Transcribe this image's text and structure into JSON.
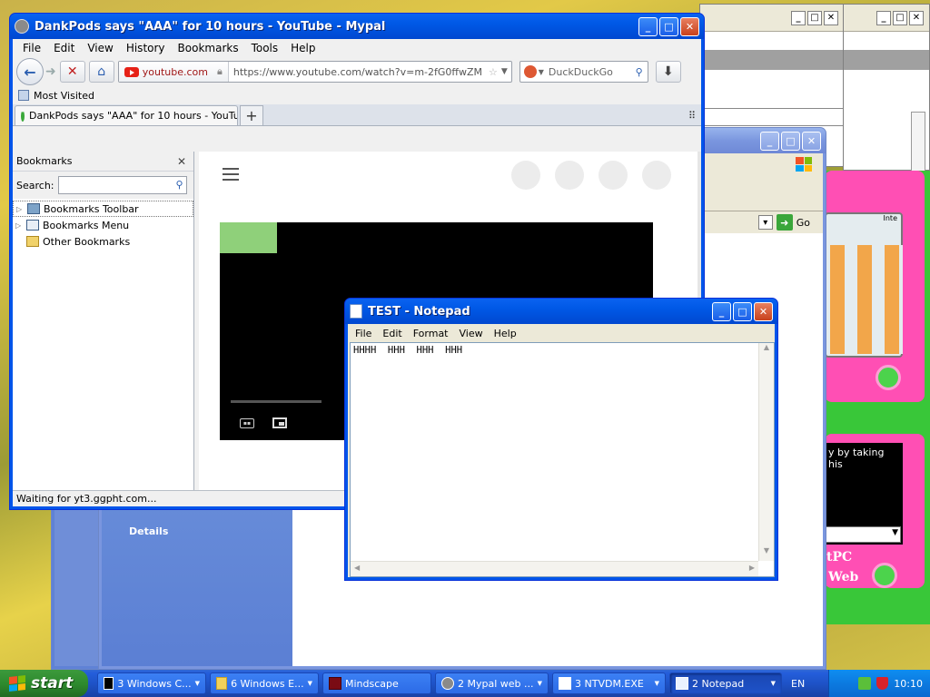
{
  "mypal": {
    "title": "DankPods says \"AAA\" for 10 hours - YouTube - Mypal",
    "menu": [
      "File",
      "Edit",
      "View",
      "History",
      "Bookmarks",
      "Tools",
      "Help"
    ],
    "identity": "youtube.com",
    "url": "https://www.youtube.com/watch?v=m-2fG0ffwZM",
    "search_engine": "DuckDuckGo",
    "bookmarks_bar_item": "Most Visited",
    "tab_title": "DankPods says \"AAA\" for 10 hours - YouTube",
    "new_tab": "+",
    "sidebar": {
      "title": "Bookmarks",
      "search_label": "Search:",
      "items": [
        "Bookmarks Toolbar",
        "Bookmarks Menu",
        "Other Bookmarks"
      ]
    },
    "status": "Waiting for yt3.ggpht.com..."
  },
  "notepad": {
    "title": "TEST - Notepad",
    "menu": [
      "File",
      "Edit",
      "Format",
      "View",
      "Help"
    ],
    "text": "HHHH  HHH  HHH  HHH"
  },
  "bg_windows": {
    "go_label": "Go",
    "app_text_1": "Inte",
    "app_text_2": "y by taking his",
    "app_text_3": "tPC",
    "app_text_4": "Web",
    "details_label": "Details"
  },
  "taskbar": {
    "start_label": "start",
    "buttons": [
      {
        "label": "3 Windows C..."
      },
      {
        "label": "6 Windows E..."
      },
      {
        "label": "Mindscape"
      },
      {
        "label": "2 Mypal web ..."
      },
      {
        "label": "3 NTVDM.EXE"
      },
      {
        "label": "2 Notepad"
      }
    ],
    "language": "EN",
    "clock": "10:10"
  },
  "colors": {
    "xp_blue": "#0055ea",
    "start_green": "#2e8b2e",
    "desktop_yellow": "#d9c247",
    "app_pink": "#ff4fb4",
    "app_green": "#4cd34c"
  }
}
